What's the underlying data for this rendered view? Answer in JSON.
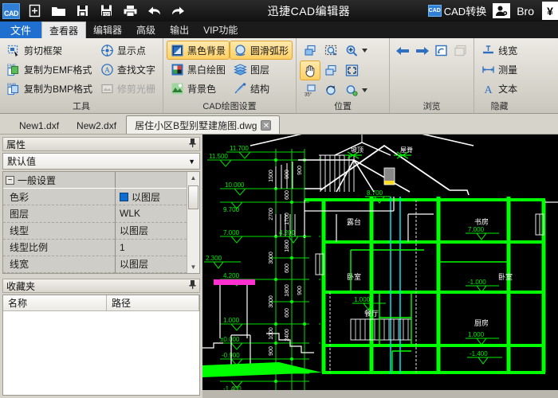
{
  "titlebar": {
    "app_logo": "cad-logo",
    "title": "迅捷CAD编辑器",
    "quick_access": [
      {
        "name": "new-file-icon",
        "label": "新建"
      },
      {
        "name": "open-folder-icon",
        "label": "打开"
      },
      {
        "name": "save-icon",
        "label": "保存"
      },
      {
        "name": "save-pdf-icon",
        "label": "另存为PDF"
      },
      {
        "name": "print-icon",
        "label": "打印"
      },
      {
        "name": "undo-icon",
        "label": "撤销"
      },
      {
        "name": "redo-icon",
        "label": "重做"
      }
    ],
    "cad_convert": "CAD转换",
    "user_icon": "user-account-icon",
    "username": "Bro",
    "currency_button": "¥"
  },
  "tabs": [
    {
      "label": "文件",
      "state": "file"
    },
    {
      "label": "查看器",
      "state": "active"
    },
    {
      "label": "编辑器",
      "state": "normal"
    },
    {
      "label": "高级",
      "state": "normal"
    },
    {
      "label": "输出",
      "state": "normal"
    },
    {
      "label": "VIP功能",
      "state": "normal"
    }
  ],
  "ribbon": {
    "groups": [
      {
        "title": "工具",
        "columns": [
          {
            "items": [
              {
                "label": "剪切框架",
                "icon": "crop-frame-icon",
                "state": "normal"
              },
              {
                "label": "复制为EMF格式",
                "icon": "copy-emf-icon",
                "state": "normal"
              },
              {
                "label": "复制为BMP格式",
                "icon": "copy-bmp-icon",
                "state": "normal"
              }
            ]
          },
          {
            "items": [
              {
                "label": "显示点",
                "icon": "show-point-icon",
                "state": "normal"
              },
              {
                "label": "查找文字",
                "icon": "find-text-icon",
                "state": "normal"
              },
              {
                "label": "修剪光栅",
                "icon": "trim-raster-icon",
                "state": "disabled"
              }
            ]
          }
        ]
      },
      {
        "title": "CAD绘图设置",
        "columns": [
          {
            "items": [
              {
                "label": "黑色背景",
                "icon": "black-background-icon",
                "state": "highlighted"
              },
              {
                "label": "黑白绘图",
                "icon": "bw-drawing-icon",
                "state": "normal"
              },
              {
                "label": "背景色",
                "icon": "background-color-icon",
                "state": "normal"
              }
            ]
          },
          {
            "items": [
              {
                "label": "圆滑弧形",
                "icon": "smooth-arc-icon",
                "state": "highlighted"
              },
              {
                "label": "图层",
                "icon": "layers-icon",
                "state": "normal"
              },
              {
                "label": "结构",
                "icon": "structure-icon",
                "state": "normal"
              }
            ]
          }
        ]
      },
      {
        "title": "位置",
        "icon_grid": [
          {
            "name": "zoom-window-icon",
            "state": "normal",
            "caret": false
          },
          {
            "name": "zoom-selection-icon",
            "state": "normal",
            "caret": false
          },
          {
            "name": "zoom-in-icon",
            "state": "normal",
            "caret": true
          },
          {
            "name": "pan-hand-icon",
            "state": "highlighted",
            "caret": false
          },
          {
            "name": "zoom-previous-icon",
            "state": "normal",
            "caret": false
          },
          {
            "name": "zoom-extents-icon",
            "state": "normal",
            "caret": false
          },
          {
            "name": "zoom-out-icon",
            "state": "normal",
            "caret": true
          },
          {
            "name": "spacer",
            "state": "blank",
            "caret": false
          },
          {
            "name": "rotate-35-icon",
            "state": "normal",
            "caret": false
          },
          {
            "name": "zoom-refresh-icon",
            "state": "normal",
            "caret": false
          },
          {
            "name": "zoom-scale-icon",
            "state": "normal",
            "caret": true
          },
          {
            "name": "spacer",
            "state": "blank",
            "caret": false
          }
        ]
      },
      {
        "title": "浏览",
        "icon_grid": [
          {
            "name": "arrow-left-icon",
            "state": "normal",
            "caret": false
          },
          {
            "name": "arrow-right-icon",
            "state": "normal",
            "caret": false
          },
          {
            "name": "refresh-view-icon",
            "state": "normal",
            "caret": false
          },
          {
            "name": "restore-view-icon",
            "state": "disabled",
            "caret": false
          }
        ]
      },
      {
        "title": "隐藏",
        "columns": [
          {
            "items": [
              {
                "label": "线宽",
                "icon": "lineweight-icon",
                "state": "normal"
              },
              {
                "label": "测量",
                "icon": "measure-icon",
                "state": "normal"
              },
              {
                "label": "文本",
                "icon": "text-icon",
                "state": "normal"
              }
            ]
          }
        ]
      }
    ]
  },
  "doc_tabs": [
    {
      "label": "New1.dxf",
      "active": false,
      "closable": false
    },
    {
      "label": "New2.dxf",
      "active": false,
      "closable": false
    },
    {
      "label": "居住小区B型别墅建施图.dwg",
      "active": true,
      "closable": true,
      "close_glyph": "✕"
    }
  ],
  "properties_panel": {
    "title": "属性",
    "pin_icon": "pin-icon",
    "selector_value": "默认值",
    "caret_glyph": "▼",
    "group_label": "一般设置",
    "expander_glyph": "−",
    "rows": [
      {
        "name": "色彩",
        "value": "以图层",
        "swatch": "#0a6ed1"
      },
      {
        "name": "图层",
        "value": "WLK",
        "swatch": null
      },
      {
        "name": "线型",
        "value": "以图层",
        "swatch": null
      },
      {
        "name": "线型比例",
        "value": "1",
        "swatch": null
      },
      {
        "name": "线宽",
        "value": "以图层",
        "swatch": null
      }
    ],
    "scroll_up_glyph": "▲",
    "scroll_down_glyph": "▼"
  },
  "favorites_panel": {
    "title": "收藏夹",
    "pin_icon": "pin-icon",
    "columns": [
      "名称",
      "路径"
    ],
    "rows": []
  },
  "drawing": {
    "name": "building-section-elevation",
    "background": "#000000",
    "colors": {
      "green": "#00e000",
      "bright_green": "#00ff00",
      "white": "#ffffff",
      "cyan": "#00d8e8",
      "magenta": "#ff00ff",
      "yellow": "#ffff00"
    },
    "left_elevation_marks": [
      "11.500",
      "11.700",
      "10.000",
      "9.700",
      "7.000",
      "4.200",
      "1.000",
      "±0.000",
      "-0.900",
      "-1.400"
    ],
    "right_elevation_marks": [
      "8.700",
      "7.000",
      "-1.000",
      "1.000",
      "-1.400",
      "2.300"
    ],
    "room_labels": [
      "露台",
      "书房",
      "卧室",
      "卧室",
      "餐厅",
      "厨房"
    ],
    "vertical_dimensions": [
      "2700",
      "1500",
      "1700",
      "900",
      "3000",
      "1800",
      "600",
      "1000",
      "2400",
      "900"
    ],
    "roof_annotations": [
      "坡顶",
      "屋脊"
    ]
  }
}
